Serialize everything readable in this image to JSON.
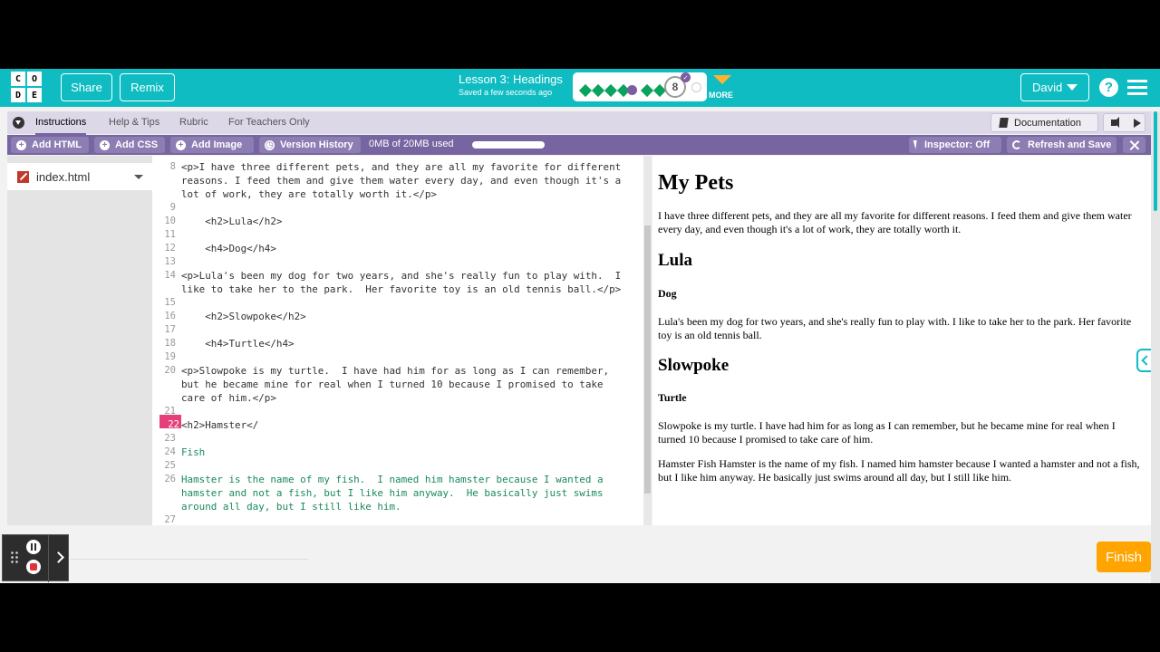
{
  "header": {
    "logo_letters": [
      "C",
      "O",
      "D",
      "E"
    ],
    "share_label": "Share",
    "remix_label": "Remix",
    "lesson_title": "Lesson 3: Headings",
    "saved_status": "Saved a few seconds ago",
    "progress": {
      "current_level": "8",
      "dots": [
        "completed",
        "completed",
        "completed",
        "completed",
        "assessment",
        "completed",
        "completed",
        "current",
        "not-started"
      ]
    },
    "more_label": "MORE",
    "user_name": "David",
    "accent_color": "#0ebcc2"
  },
  "instructions_tabs": [
    "Instructions",
    "Help & Tips",
    "Rubric",
    "For Teachers Only"
  ],
  "documentation_label": "Documentation",
  "toolbar": {
    "add_html": "Add HTML",
    "add_css": "Add CSS",
    "add_image": "Add Image",
    "version_history": "Version History",
    "storage": "0MB of 20MB used",
    "inspector": "Inspector: Off",
    "refresh": "Refresh and Save",
    "color": "#7665a0"
  },
  "file_panel": {
    "filename": "index.html"
  },
  "editor": {
    "active_line": "22",
    "lines": [
      {
        "n": "8",
        "text": "<p>I have three different pets, and they are all my favorite for different"
      },
      {
        "n": "",
        "text": "reasons. I feed them and give them water every day, and even though it's a"
      },
      {
        "n": "",
        "text": "lot of work, they are totally worth it.</p>"
      },
      {
        "n": "9",
        "text": ""
      },
      {
        "n": "10",
        "text": "    <h2>Lula</h2>"
      },
      {
        "n": "11",
        "text": ""
      },
      {
        "n": "12",
        "text": "    <h4>Dog</h4>"
      },
      {
        "n": "13",
        "text": ""
      },
      {
        "n": "14",
        "text": "<p>Lula's been my dog for two years, and she's really fun to play with.  I"
      },
      {
        "n": "",
        "text": "like to take her to the park.  Her favorite toy is an old tennis ball.</p>"
      },
      {
        "n": "15",
        "text": ""
      },
      {
        "n": "16",
        "text": "    <h2>Slowpoke</h2>"
      },
      {
        "n": "17",
        "text": ""
      },
      {
        "n": "18",
        "text": "    <h4>Turtle</h4>"
      },
      {
        "n": "19",
        "text": ""
      },
      {
        "n": "20",
        "text": "<p>Slowpoke is my turtle.  I have had him for as long as I can remember,"
      },
      {
        "n": "",
        "text": "but he became mine for real when I turned 10 because I promised to take"
      },
      {
        "n": "",
        "text": "care of him.</p>"
      },
      {
        "n": "21",
        "text": ""
      },
      {
        "n": "22",
        "text": "<h2>Hamster</"
      },
      {
        "n": "23",
        "text": ""
      },
      {
        "n": "24",
        "text": "Fish"
      },
      {
        "n": "25",
        "text": ""
      },
      {
        "n": "26",
        "text": "Hamster is the name of my fish.  I named him hamster because I wanted a"
      },
      {
        "n": "",
        "text": "hamster and not a fish, but I like him anyway.  He basically just swims"
      },
      {
        "n": "",
        "text": "around all day, but I still like him."
      },
      {
        "n": "27",
        "text": ""
      }
    ]
  },
  "preview": {
    "title": "My Pets",
    "intro": "I have three different pets, and they are all my favorite for different reasons. I feed them and give them water every day, and even though it's a lot of work, they are totally worth it.",
    "pet1_name": "Lula",
    "pet1_type": "Dog",
    "pet1_text": "Lula's been my dog for two years, and she's really fun to play with. I like to take her to the park. Her favorite toy is an old tennis ball.",
    "pet2_name": "Slowpoke",
    "pet2_type": "Turtle",
    "pet2_text": "Slowpoke is my turtle. I have had him for as long as I can remember, but he became mine for real when I turned 10 because I promised to take care of him.",
    "pet3_text": "Hamster Fish Hamster is the name of my fish. I named him hamster because I wanted a hamster and not a fish, but I like him anyway. He basically just swims around all day, but I still like him."
  },
  "finish_label": "Finish",
  "finish_color": "#ffa400"
}
